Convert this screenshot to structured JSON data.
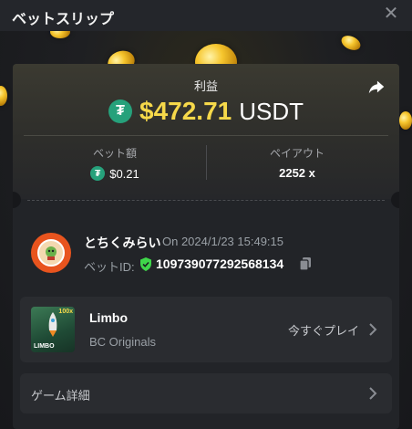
{
  "window": {
    "title": "ベットスリップ"
  },
  "profit": {
    "label": "利益",
    "currency_symbol": "₮",
    "amount": "$472.71",
    "currency": "USDT"
  },
  "stats": {
    "bet_amount_label": "ベット額",
    "bet_amount_value": "$0.21",
    "payout_label": "ペイアウト",
    "payout_value": "2252 x"
  },
  "user": {
    "name": "とちくみらい",
    "timestamp": "On 2024/1/23 15:49:15",
    "bet_id_label": "ベットID:",
    "bet_id": "109739077292568134"
  },
  "game": {
    "name": "Limbo",
    "provider": "BC Originals",
    "play_label": "今すぐプレイ",
    "thumb_label": "LIMBO",
    "thumb_multiplier": "100x"
  },
  "details": {
    "label": "ゲーム詳細"
  },
  "colors": {
    "accent_gold": "#f6d94a",
    "usdt_green": "#26a17b",
    "verified_green": "#3fd64a"
  }
}
